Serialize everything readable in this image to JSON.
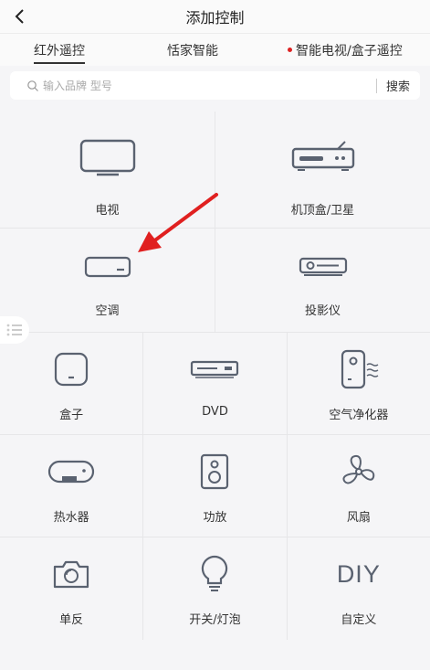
{
  "header": {
    "title": "添加控制"
  },
  "tabs": [
    {
      "label": "红外遥控",
      "active": true
    },
    {
      "label": "恬家智能",
      "active": false
    },
    {
      "label": "智能电视/盒子遥控",
      "active": false,
      "dot": true
    }
  ],
  "search": {
    "placeholder": "输入品牌 型号",
    "button": "搜索"
  },
  "devices_row1": [
    {
      "label": "电视",
      "icon": "tv-icon"
    },
    {
      "label": "机顶盒/卫星",
      "icon": "set-top-box-icon"
    }
  ],
  "devices_row2": [
    {
      "label": "空调",
      "icon": "air-conditioner-icon"
    },
    {
      "label": "投影仪",
      "icon": "projector-icon"
    }
  ],
  "devices_row3": [
    {
      "label": "盒子",
      "icon": "box-icon"
    },
    {
      "label": "DVD",
      "icon": "dvd-icon"
    },
    {
      "label": "空气净化器",
      "icon": "air-purifier-icon"
    }
  ],
  "devices_row4": [
    {
      "label": "热水器",
      "icon": "water-heater-icon"
    },
    {
      "label": "功放",
      "icon": "amplifier-icon"
    },
    {
      "label": "风扇",
      "icon": "fan-icon"
    }
  ],
  "devices_row5": [
    {
      "label": "单反",
      "icon": "camera-icon"
    },
    {
      "label": "开关/灯泡",
      "icon": "bulb-icon"
    },
    {
      "label": "自定义",
      "icon": "diy-icon",
      "icon_text": "DIY"
    }
  ],
  "colors": {
    "icon": "#5a6270",
    "arrow": "#e02020",
    "background": "#f5f5f7"
  }
}
